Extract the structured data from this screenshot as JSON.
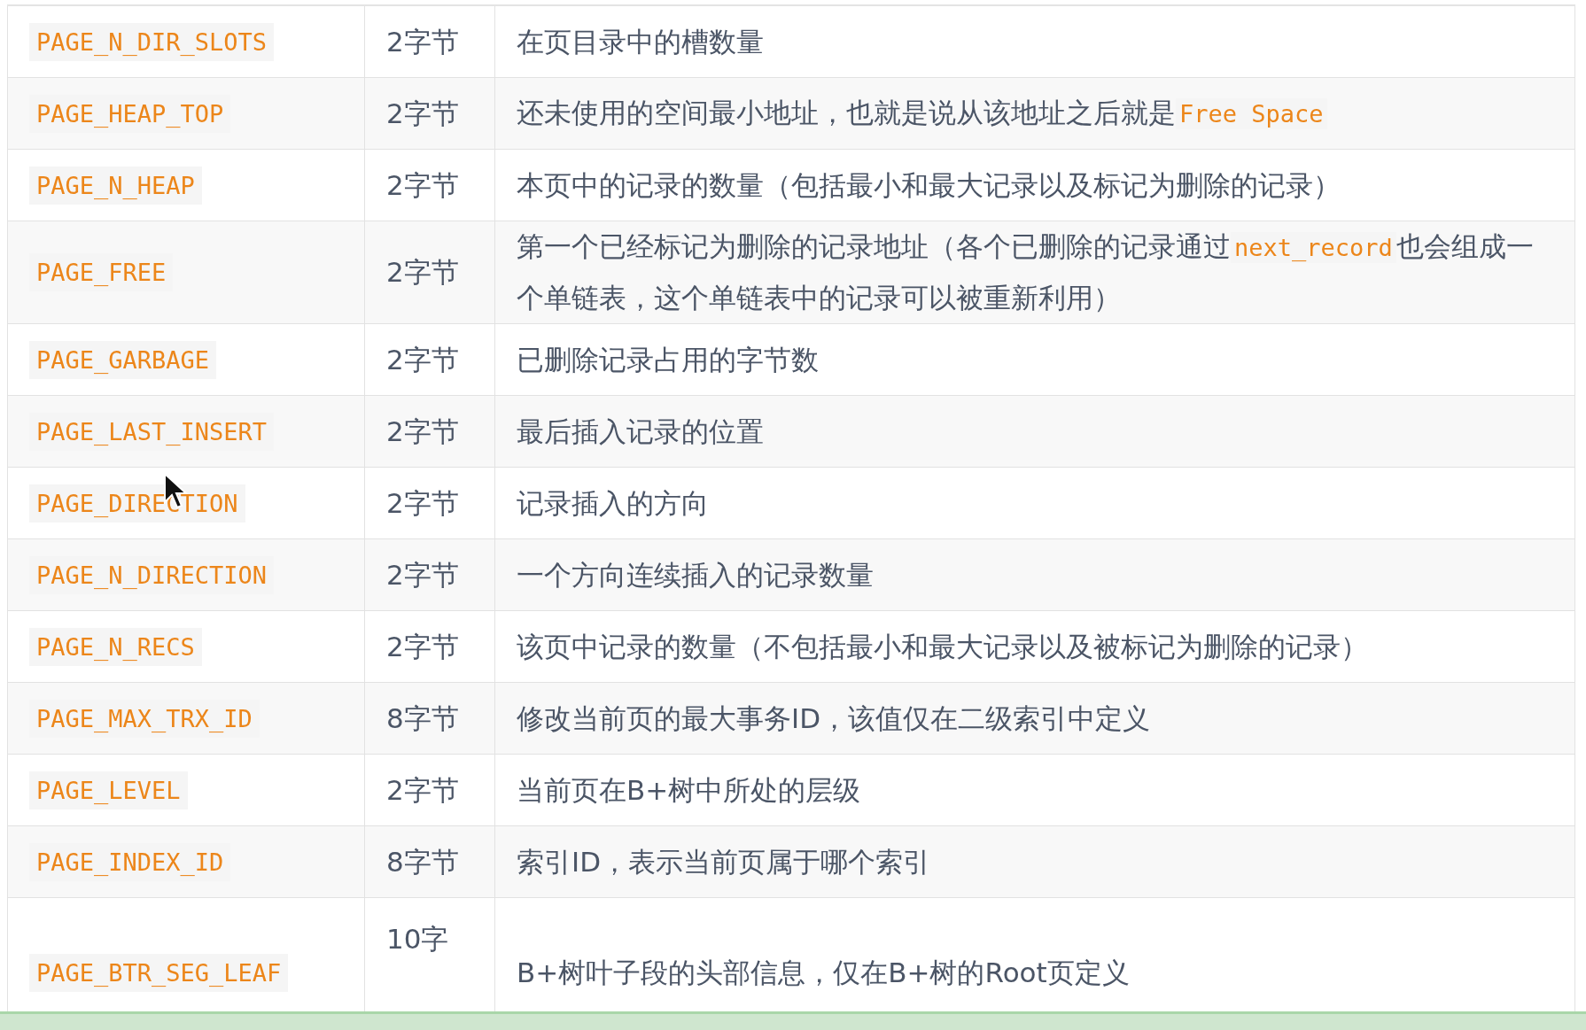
{
  "table": {
    "rows": [
      {
        "field": "PAGE_N_DIR_SLOTS",
        "size": "2字节",
        "description": [
          {
            "kind": "text",
            "text": "在页目录中的槽数量"
          }
        ]
      },
      {
        "field": "PAGE_HEAP_TOP",
        "size": "2字节",
        "description": [
          {
            "kind": "text",
            "text": "还未使用的空间最小地址，也就是说从该地址之后就是"
          },
          {
            "kind": "code",
            "text": "Free Space"
          }
        ]
      },
      {
        "field": "PAGE_N_HEAP",
        "size": "2字节",
        "description": [
          {
            "kind": "text",
            "text": "本页中的记录的数量（包括最小和最大记录以及标记为删除的记录）"
          }
        ]
      },
      {
        "field": "PAGE_FREE",
        "size": "2字节",
        "description": [
          {
            "kind": "text",
            "text": "第一个已经标记为删除的记录地址（各个已删除的记录通过"
          },
          {
            "kind": "code",
            "text": "next_record"
          },
          {
            "kind": "text",
            "text": "也会组成一个单链表，这个单链表中的记录可以被重新利用）"
          }
        ]
      },
      {
        "field": "PAGE_GARBAGE",
        "size": "2字节",
        "description": [
          {
            "kind": "text",
            "text": "已删除记录占用的字节数"
          }
        ]
      },
      {
        "field": "PAGE_LAST_INSERT",
        "size": "2字节",
        "description": [
          {
            "kind": "text",
            "text": "最后插入记录的位置"
          }
        ]
      },
      {
        "field": "PAGE_DIRECTION",
        "size": "2字节",
        "description": [
          {
            "kind": "text",
            "text": "记录插入的方向"
          }
        ]
      },
      {
        "field": "PAGE_N_DIRECTION",
        "size": "2字节",
        "description": [
          {
            "kind": "text",
            "text": "一个方向连续插入的记录数量"
          }
        ]
      },
      {
        "field": "PAGE_N_RECS",
        "size": "2字节",
        "description": [
          {
            "kind": "text",
            "text": "该页中记录的数量（不包括最小和最大记录以及被标记为删除的记录）"
          }
        ]
      },
      {
        "field": "PAGE_MAX_TRX_ID",
        "size": "8字节",
        "description": [
          {
            "kind": "text",
            "text": "修改当前页的最大事务ID，该值仅在二级索引中定义"
          }
        ]
      },
      {
        "field": "PAGE_LEVEL",
        "size": "2字节",
        "description": [
          {
            "kind": "text",
            "text": "当前页在B+树中所处的层级"
          }
        ]
      },
      {
        "field": "PAGE_INDEX_ID",
        "size": "8字节",
        "description": [
          {
            "kind": "text",
            "text": "索引ID，表示当前页属于哪个索引"
          }
        ]
      },
      {
        "field": "PAGE_BTR_SEG_LEAF",
        "size": "10字",
        "description": [
          {
            "kind": "text",
            "text": "B+树叶子段的头部信息，仅在B+树的Root页定义"
          }
        ]
      }
    ]
  }
}
